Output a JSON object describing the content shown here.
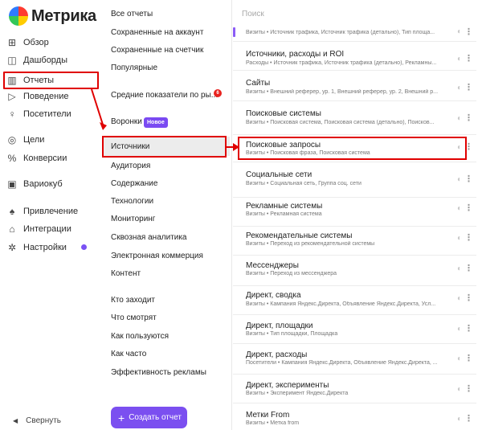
{
  "brand": {
    "name": "Метрика"
  },
  "left_nav": {
    "items": [
      {
        "label": "Обзор",
        "icon": "grid-icon"
      },
      {
        "label": "Дашборды",
        "icon": "dashboard-icon"
      },
      {
        "label": "Отчеты",
        "icon": "reports-icon"
      },
      {
        "label": "Поведение",
        "icon": "play-icon"
      },
      {
        "label": "Посетители",
        "icon": "user-icon"
      },
      {
        "label": "Цели",
        "icon": "target-icon"
      },
      {
        "label": "Конверсии",
        "icon": "percent-icon"
      },
      {
        "label": "Вариокуб",
        "icon": "cube-icon"
      },
      {
        "label": "Привлечение",
        "icon": "flame-icon"
      },
      {
        "label": "Интеграции",
        "icon": "integrations-icon"
      },
      {
        "label": "Настройки",
        "icon": "gear-icon"
      }
    ],
    "collapse_label": "Свернуть"
  },
  "mid_nav": {
    "items": [
      "Все отчеты",
      "Сохраненные на аккаунт",
      "Сохраненные на счетчик",
      "Популярные",
      "Средние показатели по ры...",
      "Воронки",
      "Источники",
      "Аудитория",
      "Содержание",
      "Технологии",
      "Мониторинг",
      "Сквозная аналитика",
      "Электронная коммерция",
      "Контент",
      "Кто заходит",
      "Что смотрят",
      "Как пользуются",
      "Как часто",
      "Эффективность рекламы"
    ],
    "badge_new": "Новое",
    "badge_count": "6",
    "create_button": "Создать отчет"
  },
  "search": {
    "placeholder": "Поиск"
  },
  "reports": [
    {
      "title": "",
      "sub": "Визиты • Источник трафика, Источник трафика (детально), Тип площа..."
    },
    {
      "title": "Источники, расходы и ROI",
      "sub": "Расходы • Источник трафика, Источник трафика (детально), Рекламны..."
    },
    {
      "title": "Сайты",
      "sub": "Визиты • Внешний реферер, ур. 1, Внешний реферер, ур. 2, Внешний р..."
    },
    {
      "title": "Поисковые системы",
      "sub": "Визиты • Поисковая система, Поисковая система (детально), Поисков..."
    },
    {
      "title": "Поисковые запросы",
      "sub": "Визиты • Поисковая фраза, Поисковая система"
    },
    {
      "title": "Социальные сети",
      "sub": "Визиты • Социальная сеть, Группа соц. сети"
    },
    {
      "title": "Рекламные системы",
      "sub": "Визиты • Рекламная система"
    },
    {
      "title": "Рекомендательные системы",
      "sub": "Визиты • Переход из рекомендательной системы"
    },
    {
      "title": "Мессенджеры",
      "sub": "Визиты • Переход из мессенджера"
    },
    {
      "title": "Директ, сводка",
      "sub": "Визиты • Кампания Яндекс.Директа, Объявление Яндекс.Директа, Усл..."
    },
    {
      "title": "Директ, площадки",
      "sub": "Визиты • Тип площадки, Площадка"
    },
    {
      "title": "Директ, расходы",
      "sub": "Посетители • Кампания Яндекс.Директа, Объявление Яндекс.Директа, ..."
    },
    {
      "title": "Директ, эксперименты",
      "sub": "Визиты • Эксперимент Яндекс.Директа"
    },
    {
      "title": "Метки From",
      "sub": "Визиты • Метка from"
    }
  ],
  "colors": {
    "accent": "#7b4ff0",
    "highlight": "#e00000",
    "selected_bg": "#ececec"
  }
}
